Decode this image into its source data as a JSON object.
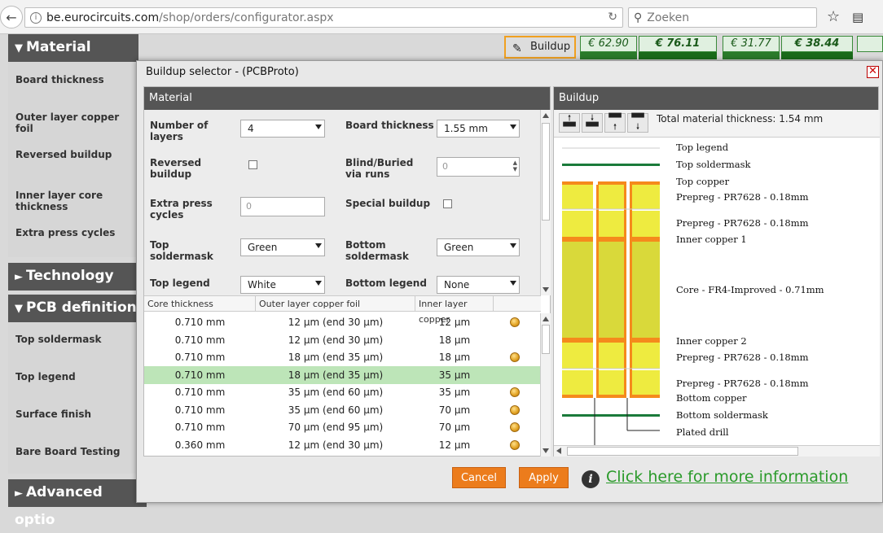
{
  "browser": {
    "url_host": "be.eurocircuits.com",
    "url_path": "/shop/orders/configurator.aspx",
    "search_placeholder": "Zoeken"
  },
  "left": {
    "material_header": "Material",
    "material_items": [
      "Board thickness",
      "Outer layer copper foil",
      "Reversed buildup",
      "Inner layer core thickness",
      "Extra press cycles"
    ],
    "technology_header": "Technology",
    "pcbdef_header": "PCB definition",
    "pcbdef_items": [
      "Top soldermask",
      "Top legend",
      "Surface finish",
      "Bare Board Testing"
    ],
    "advanced_header": "Advanced optio"
  },
  "buildup_button": "Buildup",
  "prices": {
    "p1": "€ 62.90",
    "p2": "€ 76.11",
    "p3": "€ 31.77",
    "p4": "€ 38.44"
  },
  "modal": {
    "title": "Buildup selector - (PCBProto)",
    "material_title": "Material",
    "buildup_title": "Buildup",
    "form": {
      "num_layers_label": "Number of layers",
      "num_layers_value": "4",
      "board_thickness_label": "Board thickness",
      "board_thickness_value": "1.55 mm",
      "reversed_label": "Reversed buildup",
      "blind_label": "Blind/Buried via runs",
      "blind_value": "0",
      "extra_press_label": "Extra press cycles",
      "extra_press_value": "0",
      "special_label": "Special buildup",
      "top_mask_label": "Top soldermask",
      "top_mask_value": "Green",
      "bottom_mask_label": "Bottom soldermask",
      "bottom_mask_value": "Green",
      "top_legend_label": "Top legend",
      "top_legend_value": "White",
      "bottom_legend_label": "Bottom legend",
      "bottom_legend_value": "None"
    },
    "grid": {
      "headers": [
        "Core thickness",
        "Outer layer copper foil",
        "Inner layer copper"
      ],
      "rows": [
        {
          "core": "0.710 mm",
          "outer": "12 µm (end 30 µm)",
          "inner": "12 µm",
          "coin": true,
          "selected": false
        },
        {
          "core": "0.710 mm",
          "outer": "12 µm (end 30 µm)",
          "inner": "18 µm",
          "coin": false,
          "selected": false
        },
        {
          "core": "0.710 mm",
          "outer": "18 µm (end 35 µm)",
          "inner": "18 µm",
          "coin": true,
          "selected": false
        },
        {
          "core": "0.710 mm",
          "outer": "18 µm (end 35 µm)",
          "inner": "35 µm",
          "coin": false,
          "selected": true
        },
        {
          "core": "0.710 mm",
          "outer": "35 µm (end 60 µm)",
          "inner": "35 µm",
          "coin": true,
          "selected": false
        },
        {
          "core": "0.710 mm",
          "outer": "35 µm (end 60 µm)",
          "inner": "70 µm",
          "coin": true,
          "selected": false
        },
        {
          "core": "0.710 mm",
          "outer": "70 µm (end 95 µm)",
          "inner": "70 µm",
          "coin": true,
          "selected": false
        },
        {
          "core": "0.360 mm",
          "outer": "12 µm (end 30 µm)",
          "inner": "12 µm",
          "coin": true,
          "selected": false
        }
      ]
    },
    "total_thickness": "Total material thickness: 1.54 mm",
    "stack_labels": {
      "top_legend": "Top legend",
      "top_mask": "Top soldermask",
      "top_copper": "Top copper",
      "prepreg1": "Prepreg - PR7628 - 0.18mm",
      "prepreg2": "Prepreg - PR7628 - 0.18mm",
      "inner1": "Inner copper 1",
      "core": "Core - FR4-Improved - 0.71mm",
      "inner2": "Inner copper 2",
      "prepreg3": "Prepreg - PR7628 - 0.18mm",
      "prepreg4": "Prepreg - PR7628 - 0.18mm",
      "bottom_copper": "Bottom copper",
      "bottom_mask": "Bottom soldermask",
      "plated_drill": "Plated drill"
    },
    "cancel": "Cancel",
    "apply": "Apply",
    "info_link": "Click here for more information"
  },
  "colors": {
    "accent_orange": "#ec7c1c",
    "header_gray": "#555555",
    "selected_row": "#bde5b8",
    "link_green": "#2a9a2a",
    "copper": "#f58a1c",
    "prepreg": "#eeeb40",
    "core": "#d9d93a",
    "soldermask": "#1a7a3a"
  }
}
